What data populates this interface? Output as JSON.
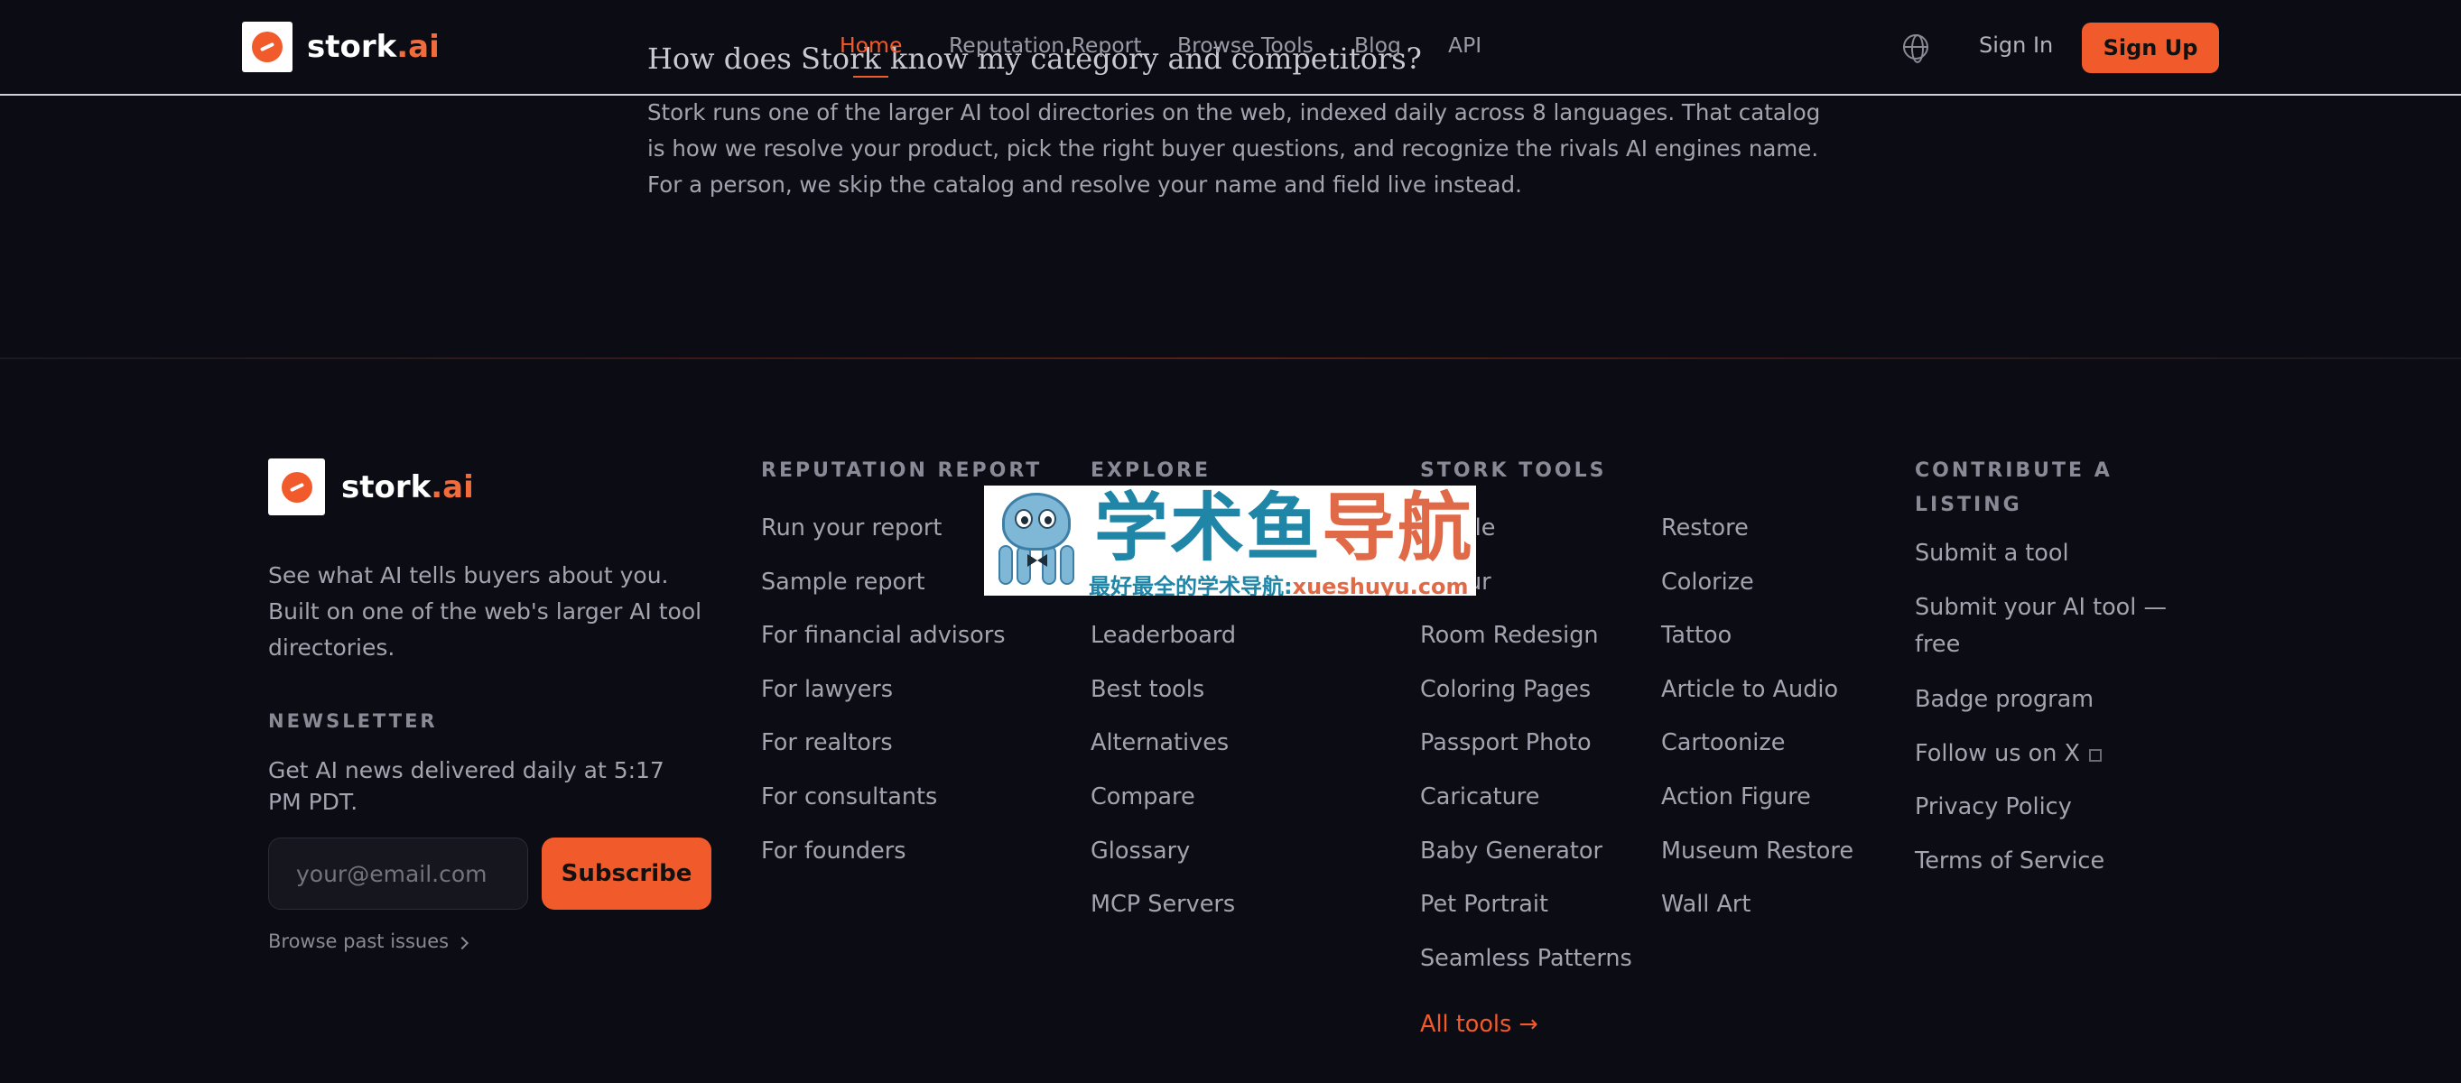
{
  "brand": {
    "name": "stork",
    "suffix": ".ai"
  },
  "faq": {
    "question": "How does Stork know my category and competitors?",
    "answer": "Stork runs one of the larger AI tool directories on the web, indexed daily across 8 languages. That catalog is how we resolve your product, pick the right buyer questions, and recognize the rivals AI engines name. For a person, we skip the catalog and resolve your name and field live instead."
  },
  "header": {
    "nav": [
      "Home",
      "Reputation Report",
      "Browse Tools",
      "Blog",
      "API"
    ],
    "active": "Home",
    "globe_icon": "globe-icon",
    "sign_in": "Sign In",
    "sign_up": "Sign Up"
  },
  "footer": {
    "description": "See what AI tells buyers about you. Built on one of the web's larger AI tool directories.",
    "newsletter": {
      "heading": "NEWSLETTER",
      "text": "Get AI news delivered daily at 5:17 PM PDT.",
      "placeholder": "your@email.com",
      "button": "Subscribe",
      "past_issues": "Browse past issues"
    },
    "columns": {
      "reputation": {
        "heading": "REPUTATION REPORT",
        "links": [
          "Run your report",
          "Sample report",
          "For financial advisors",
          "For lawyers",
          "For realtors",
          "For consultants",
          "For founders"
        ]
      },
      "explore": {
        "heading": "EXPLORE",
        "links": [
          "Leaderboard",
          "Best tools",
          "Alternatives",
          "Compare",
          "Glossary",
          "MCP Servers"
        ]
      },
      "stork_tools": {
        "heading": "STORK TOOLS",
        "col1": [
          "ale",
          "ur",
          "Room Redesign",
          "Coloring Pages",
          "Passport Photo",
          "Caricature",
          "Baby Generator",
          "Pet Portrait",
          "Seamless Patterns"
        ],
        "col2": [
          "Restore",
          "Colorize",
          "Tattoo",
          "Article to Audio",
          "Cartoonize",
          "Action Figure",
          "Museum Restore",
          "Wall Art"
        ],
        "all": "All tools →"
      },
      "contribute": {
        "heading": "CONTRIBUTE A LISTING",
        "links": [
          "Submit a tool",
          "Submit your AI tool — free",
          "Badge program",
          "Follow us on X",
          "Privacy Policy",
          "Terms of Service"
        ]
      }
    }
  },
  "watermark": {
    "title_a": "学术鱼",
    "title_b": "导航",
    "sub_a": "最好最全的学术导航:",
    "sub_b": "xueshuyu.com"
  },
  "colors": {
    "accent": "#f15a2a",
    "background": "#0c0c14"
  }
}
